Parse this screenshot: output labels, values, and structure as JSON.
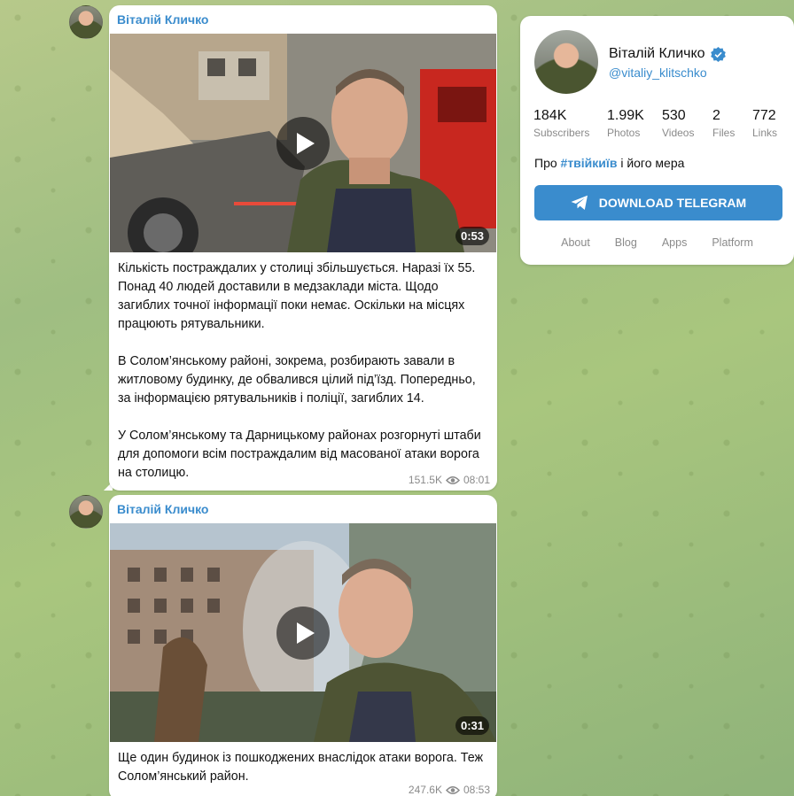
{
  "posts": [
    {
      "author": "Віталій Кличко",
      "duration": "0:53",
      "paragraphs": [
        "Кількість постраждалих у столиці збільшується. Наразі їх 55. Понад 40 людей доставили в медзаклади міста. Щодо загиблих точної інформації поки немає. Оскільки на місцях працюють рятувальники.",
        "В Солом’янському районі, зокрема, розбирають завали в житловому будинку, де обвалився цілий під’їзд. Попередньо, за інформацією рятувальників і поліції, загиблих 14.",
        "У Солом’янському та Дарницькому районах розгорнуті штаби для допомоги всім постраждалим від масованої атаки ворога на столицю."
      ],
      "views": "151.5K",
      "time": "08:01"
    },
    {
      "author": "Віталій Кличко",
      "duration": "0:31",
      "paragraphs": [
        "Ще один будинок із пошкоджених внаслідок атаки ворога. Теж Солом’янський район."
      ],
      "views": "247.6K",
      "time": "08:53"
    }
  ],
  "channel": {
    "name": "Віталій Кличко",
    "handle": "@vitaliy_klitschko",
    "stats": [
      {
        "value": "184K",
        "label": "Subscribers"
      },
      {
        "value": "1.99K",
        "label": "Photos"
      },
      {
        "value": "530",
        "label": "Videos"
      },
      {
        "value": "2",
        "label": "Files"
      },
      {
        "value": "772",
        "label": "Links"
      }
    ],
    "about_prefix": "Про",
    "about_tag": "#твійкиїв",
    "about_suffix": "і його мера",
    "download_label": "DOWNLOAD TELEGRAM",
    "footer_links": [
      "About",
      "Blog",
      "Apps",
      "Platform"
    ]
  },
  "colors": {
    "accent": "#3a8ccd"
  }
}
